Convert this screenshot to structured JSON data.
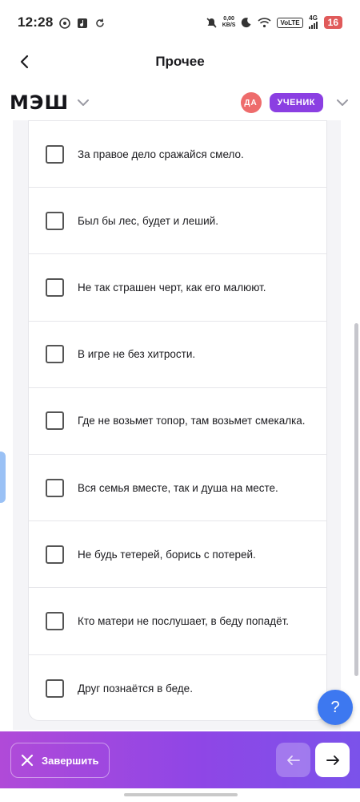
{
  "status_bar": {
    "time": "12:28",
    "net_speed_value": "0,00",
    "net_speed_unit": "KB/S",
    "volte": "VoLTE",
    "network": "4G",
    "battery": "16"
  },
  "header": {
    "title": "Прочее"
  },
  "brand": {
    "logo": "МЭШ",
    "avatar_initials": "ДА",
    "role": "УЧЕНИК"
  },
  "options": [
    "За правое дело сражайся смело.",
    "Был бы лес, будет и леший.",
    "Не так страшен черт, как его малюют.",
    "В игре не без хитрости.",
    "Где не возьмет топор, там возьмет смекалка.",
    "Вся семья вместе, так и душа на месте.",
    "Не будь тетерей, борись с потерей.",
    "Кто матери не послушает, в беду попадёт.",
    "Друг познаётся в беде."
  ],
  "help": {
    "label": "?"
  },
  "bottom_bar": {
    "finish_label": "Завершить"
  },
  "colors": {
    "accent_purple": "#8b3fe2",
    "avatar_red": "#ee6c6c",
    "help_blue": "#3d78f0"
  }
}
